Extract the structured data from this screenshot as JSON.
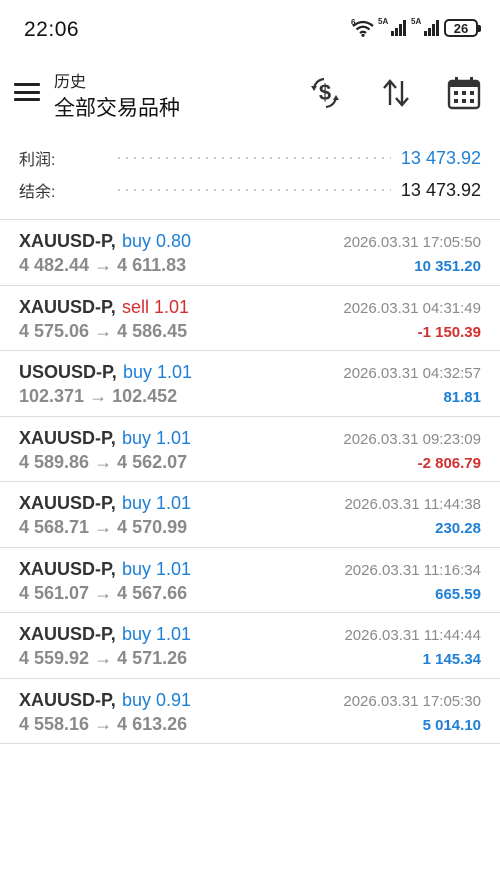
{
  "status_bar": {
    "time": "22:06",
    "sim1_label": "5A",
    "sim2_label": "5A",
    "wifi_label": "6",
    "battery": "26"
  },
  "header": {
    "subtitle": "历史",
    "title": "全部交易品种",
    "icons": [
      "menu-icon",
      "currency-exchange-icon",
      "sort-icon",
      "calendar-icon"
    ]
  },
  "summary": {
    "profit_label": "利润:",
    "profit_value": "13 473.92",
    "balance_label": "结余:",
    "balance_value": "13 473.92"
  },
  "trades": [
    {
      "symbol": "XAUUSD-P,",
      "side": "buy 0.80",
      "type": "buy",
      "prices": "4 482.44 → 4 611.83",
      "time": "2026.03.31 17:05:50",
      "profit": "10 351.20",
      "sign": "pos"
    },
    {
      "symbol": "XAUUSD-P,",
      "side": "sell 1.01",
      "type": "sell",
      "prices": "4 575.06 → 4 586.45",
      "time": "2026.03.31 04:31:49",
      "profit": "-1 150.39",
      "sign": "neg"
    },
    {
      "symbol": "USOUSD-P,",
      "side": "buy 1.01",
      "type": "buy",
      "prices": "102.371 → 102.452",
      "time": "2026.03.31 04:32:57",
      "profit": "81.81",
      "sign": "pos"
    },
    {
      "symbol": "XAUUSD-P,",
      "side": "buy 1.01",
      "type": "buy",
      "prices": "4 589.86 → 4 562.07",
      "time": "2026.03.31 09:23:09",
      "profit": "-2 806.79",
      "sign": "neg"
    },
    {
      "symbol": "XAUUSD-P,",
      "side": "buy 1.01",
      "type": "buy",
      "prices": "4 568.71 → 4 570.99",
      "time": "2026.03.31 11:44:38",
      "profit": "230.28",
      "sign": "pos"
    },
    {
      "symbol": "XAUUSD-P,",
      "side": "buy 1.01",
      "type": "buy",
      "prices": "4 561.07 → 4 567.66",
      "time": "2026.03.31 11:16:34",
      "profit": "665.59",
      "sign": "pos"
    },
    {
      "symbol": "XAUUSD-P,",
      "side": "buy 1.01",
      "type": "buy",
      "prices": "4 559.92 → 4 571.26",
      "time": "2026.03.31 11:44:44",
      "profit": "1 145.34",
      "sign": "pos"
    },
    {
      "symbol": "XAUUSD-P,",
      "side": "buy 0.91",
      "type": "buy",
      "prices": "4 558.16 → 4 613.26",
      "time": "2026.03.31 17:05:30",
      "profit": "5 014.10",
      "sign": "pos"
    }
  ],
  "colors": {
    "positive": "#1e7fd6",
    "negative": "#d32f2f",
    "muted": "#8a8a8a"
  }
}
